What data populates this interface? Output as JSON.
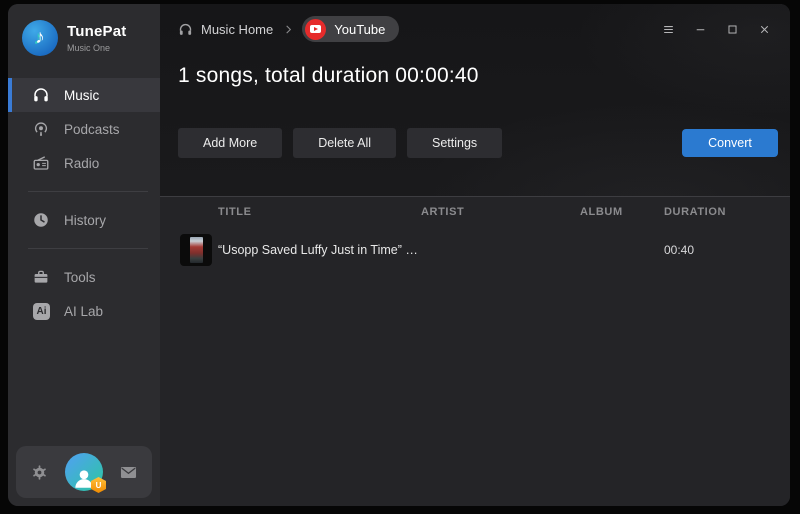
{
  "app": {
    "name": "TunePat",
    "edition": "Music One"
  },
  "titlebar": {
    "breadcrumb": {
      "home": "Music Home",
      "source": "YouTube"
    },
    "window_controls": [
      "menu",
      "minimize",
      "maximize",
      "close"
    ]
  },
  "sidebar": {
    "sections": [
      {
        "items": [
          {
            "label": "Music",
            "icon": "headphones-icon",
            "active": true
          },
          {
            "label": "Podcasts",
            "icon": "podcast-icon",
            "active": false
          },
          {
            "label": "Radio",
            "icon": "radio-icon",
            "active": false
          }
        ]
      },
      {
        "items": [
          {
            "label": "History",
            "icon": "clock-icon",
            "active": false
          }
        ]
      },
      {
        "items": [
          {
            "label": "Tools",
            "icon": "toolbox-icon",
            "active": false
          },
          {
            "label": "AI Lab",
            "icon": "ai-icon",
            "active": false
          }
        ]
      }
    ],
    "ai_glyph": "Ai",
    "footer_icons": [
      "settings-gear",
      "user-account",
      "messages-mail"
    ],
    "account_badge": "U"
  },
  "main": {
    "summary": "1 songs, total duration 00:00:40",
    "toolbar": {
      "add_more": "Add More",
      "delete_all": "Delete All",
      "settings": "Settings",
      "convert": "Convert"
    },
    "table": {
      "columns": [
        "TITLE",
        "ARTIST",
        "ALBUM",
        "DURATION"
      ],
      "rows": [
        {
          "title": "“Usopp Saved Luffy Just in Time” 😳🔥 ...",
          "artist": "",
          "album": "",
          "duration": "00:40"
        }
      ]
    }
  },
  "colors": {
    "accent_blue": "#2b7ad0",
    "active_bar_blue": "#3a7bd5",
    "youtube_red": "#e62b2b",
    "badge_orange": "#f08a00",
    "sidebar_bg": "#2c2c2f",
    "main_bg": "#242427"
  }
}
